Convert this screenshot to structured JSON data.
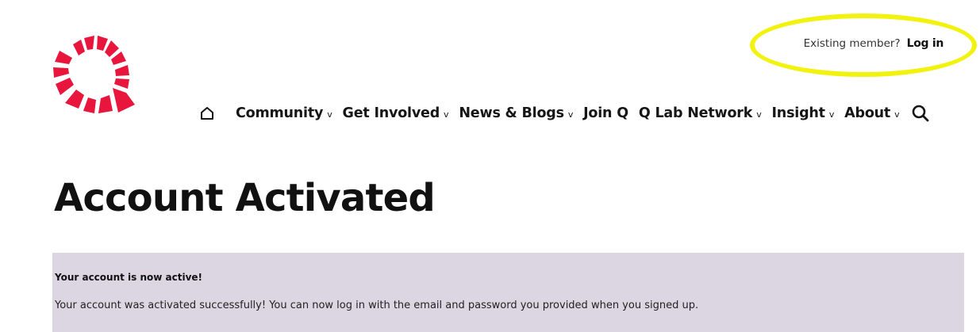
{
  "brand": {
    "logo_icon": "red-segmented-ring-icon",
    "accent_color": "#e8163d"
  },
  "member": {
    "prompt": "Existing member?",
    "login_label": "Log in",
    "highlight_color": "#f2f20f"
  },
  "nav": {
    "home_icon": "home-icon",
    "items": [
      {
        "label": "Community",
        "has_dropdown": true
      },
      {
        "label": "Get Involved",
        "has_dropdown": true
      },
      {
        "label": "News & Blogs",
        "has_dropdown": true
      },
      {
        "label": "Join Q",
        "has_dropdown": false
      },
      {
        "label": "Q Lab Network",
        "has_dropdown": true
      },
      {
        "label": "Insight",
        "has_dropdown": true
      },
      {
        "label": "About",
        "has_dropdown": true
      }
    ],
    "search_icon": "search-icon"
  },
  "main": {
    "title": "Account Activated"
  },
  "notice": {
    "title": "Your account is now active!",
    "body": "Your account was activated successfully! You can now log in with the email and password you provided when you signed up.",
    "background": "#dcd6e2"
  }
}
